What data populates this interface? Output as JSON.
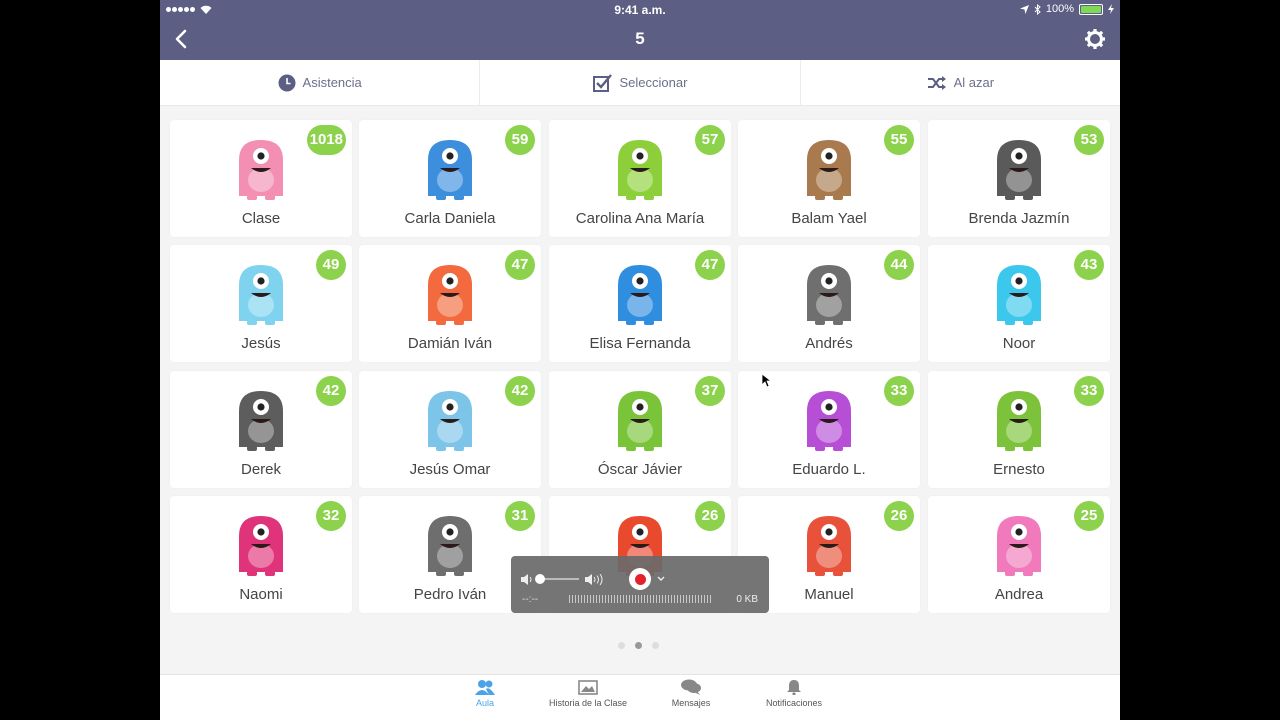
{
  "status_bar": {
    "time": "9:41 a.m.",
    "battery": "100%"
  },
  "header": {
    "title": "5"
  },
  "toolbar": {
    "attendance": "Asistencia",
    "select": "Seleccionar",
    "random": "Al azar"
  },
  "students": [
    {
      "name": "Clase",
      "points": "1018",
      "color": "#f28fb3"
    },
    {
      "name": "Carla Daniela",
      "points": "59",
      "color": "#3d8fde"
    },
    {
      "name": "Carolina Ana María",
      "points": "57",
      "color": "#8ccf3a"
    },
    {
      "name": "Balam Yael",
      "points": "55",
      "color": "#a87a4d"
    },
    {
      "name": "Brenda Jazmín",
      "points": "53",
      "color": "#5a5a5a"
    },
    {
      "name": "Jesús",
      "points": "49",
      "color": "#7fd3ef"
    },
    {
      "name": "Damián Iván",
      "points": "47",
      "color": "#f26a3d"
    },
    {
      "name": "Elisa Fernanda",
      "points": "47",
      "color": "#2f8ee0"
    },
    {
      "name": "Andrés",
      "points": "44",
      "color": "#6f6f6f"
    },
    {
      "name": "Noor",
      "points": "43",
      "color": "#3cc8ec"
    },
    {
      "name": "Derek",
      "points": "42",
      "color": "#5d5d5d"
    },
    {
      "name": "Jesús Omar",
      "points": "42",
      "color": "#7cc4e8"
    },
    {
      "name": "Óscar Jávier",
      "points": "37",
      "color": "#7ac43a"
    },
    {
      "name": "Eduardo L.",
      "points": "33",
      "color": "#b64fd6"
    },
    {
      "name": "Ernesto",
      "points": "33",
      "color": "#7cc23a"
    },
    {
      "name": "Naomi",
      "points": "32",
      "color": "#e0347a"
    },
    {
      "name": "Pedro Iván",
      "points": "31",
      "color": "#6e6e6e"
    },
    {
      "name": "",
      "points": "26",
      "color": "#e94a2e"
    },
    {
      "name": "Manuel",
      "points": "26",
      "color": "#e8523a"
    },
    {
      "name": "Andrea",
      "points": "25",
      "color": "#f07abb"
    }
  ],
  "tabs": [
    {
      "label": "Aula",
      "icon": "people-icon"
    },
    {
      "label": "Historia de la Clase",
      "icon": "photo-icon"
    },
    {
      "label": "Mensajes",
      "icon": "chat-icon"
    },
    {
      "label": "Notificaciones",
      "icon": "bell-icon"
    }
  ],
  "pager": {
    "pages": 3,
    "current": 2
  },
  "recorder": {
    "time": "--:--",
    "size": "0 KB"
  },
  "colors": {
    "header": "#5c5f83",
    "badge": "#8dd24c",
    "active_tab": "#4aa3e8"
  }
}
